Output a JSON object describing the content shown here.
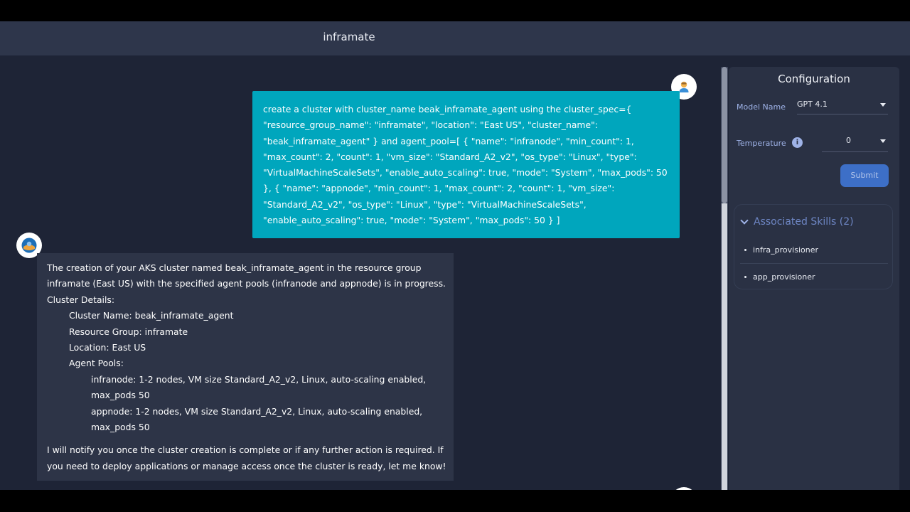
{
  "header": {
    "title": "inframate"
  },
  "chat": {
    "user_message": "create a cluster with cluster_name beak_inframate_agent using the cluster_spec={ \"resource_group_name\": \"inframate\", \"location\": \"East US\", \"cluster_name\": \"beak_inframate_agent\" } and agent_pool=[ { \"name\": \"infranode\", \"min_count\": 1, \"max_count\": 2, \"count\": 1, \"vm_size\": \"Standard_A2_v2\", \"os_type\": \"Linux\", \"type\": \"VirtualMachineScaleSets\", \"enable_auto_scaling\": true, \"mode\": \"System\", \"max_pods\": 50 }, { \"name\": \"appnode\", \"min_count\": 1, \"max_count\": 2, \"count\": 1, \"vm_size\": \"Standard_A2_v2\", \"os_type\": \"Linux\", \"type\": \"VirtualMachineScaleSets\", \"enable_auto_scaling\": true, \"mode\": \"System\", \"max_pods\": 50 } ]",
    "bot_intro": "The creation of your AKS cluster named beak_inframate_agent in the resource group inframate (East US) with the specified agent pools (infranode and appnode) is in progress.",
    "details_heading": "Cluster Details:",
    "cluster_name": "Cluster Name: beak_inframate_agent",
    "resource_group": "Resource Group: inframate",
    "location": "Location: East US",
    "agent_pools_heading": "Agent Pools:",
    "pool_infranode": "infranode: 1-2 nodes, VM size Standard_A2_v2, Linux, auto-scaling enabled, max_pods 50",
    "pool_appnode": "appnode: 1-2 nodes, VM size Standard_A2_v2, Linux, auto-scaling enabled, max_pods 50",
    "bot_outro": "I will notify you once the cluster creation is complete or if any further action is required. If you need to deploy applications or manage access once the cluster is ready, let me know!"
  },
  "config": {
    "title": "Configuration",
    "model_label": "Model Name",
    "model_value": "GPT 4.1",
    "temperature_label": "Temperature",
    "temperature_value": "0",
    "info_glyph": "i",
    "submit_label": "Submit",
    "skills_header": "Associated Skills (2)",
    "skills": [
      "infra_provisioner",
      "app_provisioner"
    ]
  },
  "icons": {
    "user_avatar": "user-avatar-icon",
    "bot_avatar": "bot-avatar-icon",
    "info": "info-icon",
    "dropdown": "chevron-down-icon",
    "collapse": "chevron-down-icon"
  },
  "colors": {
    "user_bubble": "#00a6bd",
    "bot_bubble": "#2d3447",
    "background": "#1e2436",
    "topbar": "#2e364b",
    "panel": "#2a3144",
    "submit": "#3d6fc7",
    "label": "#9fb3e8"
  }
}
